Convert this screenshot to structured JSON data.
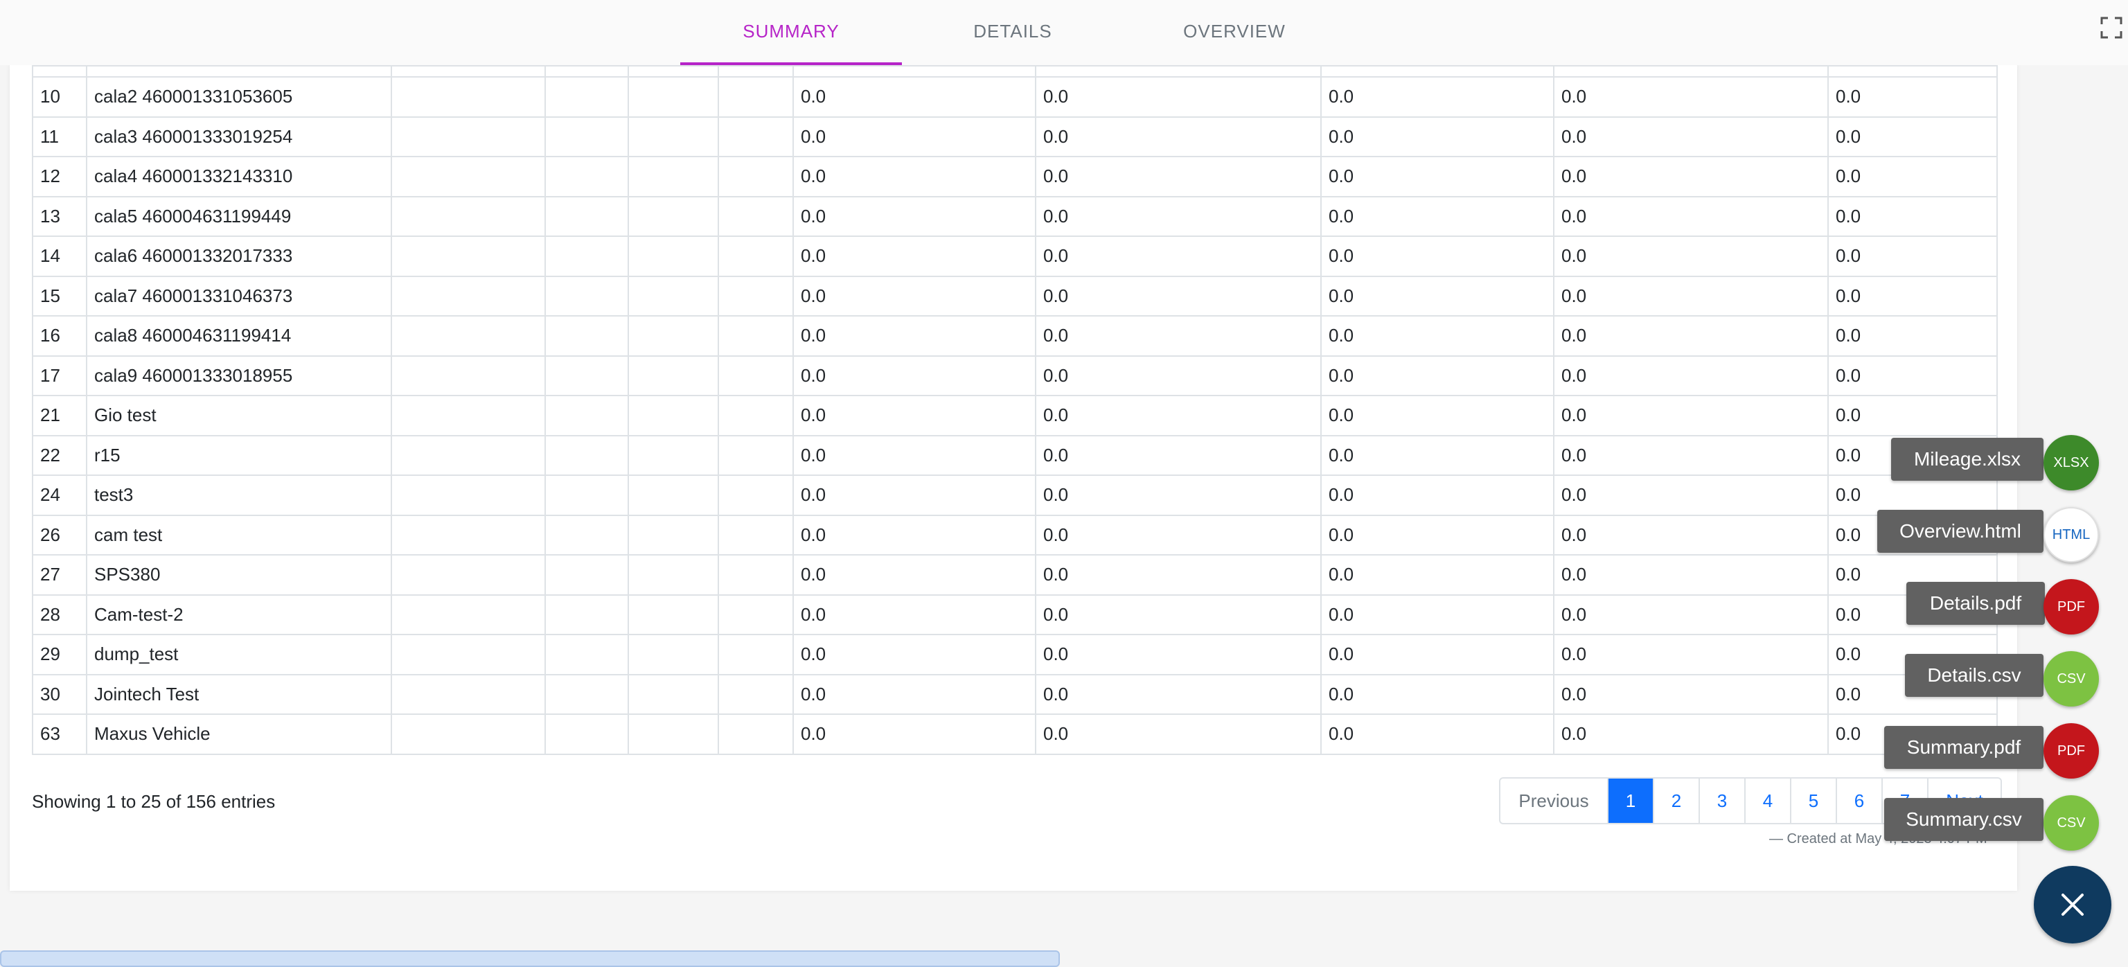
{
  "tabs": [
    {
      "label": "SUMMARY",
      "active": true
    },
    {
      "label": "DETAILS",
      "active": false
    },
    {
      "label": "OVERVIEW",
      "active": false
    }
  ],
  "table": {
    "rows": [
      {
        "id": "10",
        "name": "cala2 460001331053605",
        "values": [
          "0.0",
          "0.0",
          "0.0",
          "0.0",
          "0.0"
        ]
      },
      {
        "id": "11",
        "name": "cala3 460001333019254",
        "values": [
          "0.0",
          "0.0",
          "0.0",
          "0.0",
          "0.0"
        ]
      },
      {
        "id": "12",
        "name": "cala4 460001332143310",
        "values": [
          "0.0",
          "0.0",
          "0.0",
          "0.0",
          "0.0"
        ]
      },
      {
        "id": "13",
        "name": "cala5 460004631199449",
        "values": [
          "0.0",
          "0.0",
          "0.0",
          "0.0",
          "0.0"
        ]
      },
      {
        "id": "14",
        "name": "cala6 460001332017333",
        "values": [
          "0.0",
          "0.0",
          "0.0",
          "0.0",
          "0.0"
        ]
      },
      {
        "id": "15",
        "name": "cala7 460001331046373",
        "values": [
          "0.0",
          "0.0",
          "0.0",
          "0.0",
          "0.0"
        ]
      },
      {
        "id": "16",
        "name": "cala8 460004631199414",
        "values": [
          "0.0",
          "0.0",
          "0.0",
          "0.0",
          "0.0"
        ]
      },
      {
        "id": "17",
        "name": "cala9 460001333018955",
        "values": [
          "0.0",
          "0.0",
          "0.0",
          "0.0",
          "0.0"
        ]
      },
      {
        "id": "21",
        "name": "Gio test",
        "values": [
          "0.0",
          "0.0",
          "0.0",
          "0.0",
          "0.0"
        ]
      },
      {
        "id": "22",
        "name": "r15",
        "values": [
          "0.0",
          "0.0",
          "0.0",
          "0.0",
          "0.0"
        ]
      },
      {
        "id": "24",
        "name": "test3",
        "values": [
          "0.0",
          "0.0",
          "0.0",
          "0.0",
          "0.0"
        ]
      },
      {
        "id": "26",
        "name": "cam test",
        "values": [
          "0.0",
          "0.0",
          "0.0",
          "0.0",
          "0.0"
        ]
      },
      {
        "id": "27",
        "name": "SPS380",
        "values": [
          "0.0",
          "0.0",
          "0.0",
          "0.0",
          "0.0"
        ]
      },
      {
        "id": "28",
        "name": "Cam-test-2",
        "values": [
          "0.0",
          "0.0",
          "0.0",
          "0.0",
          "0.0"
        ]
      },
      {
        "id": "29",
        "name": "dump_test",
        "values": [
          "0.0",
          "0.0",
          "0.0",
          "0.0",
          "0.0"
        ]
      },
      {
        "id": "30",
        "name": "Jointech Test",
        "values": [
          "0.0",
          "0.0",
          "0.0",
          "0.0",
          "0.0"
        ]
      },
      {
        "id": "63",
        "name": "Maxus Vehicle",
        "values": [
          "0.0",
          "0.0",
          "0.0",
          "0.0",
          "0.0"
        ]
      }
    ]
  },
  "footer": {
    "info": "Showing 1 to 25 of 156 entries",
    "created": "— Created at May 4, 2023 4:07 PM"
  },
  "pagination": {
    "previous": "Previous",
    "pages": [
      "1",
      "2",
      "3",
      "4",
      "5",
      "6",
      "7"
    ],
    "active_page": "1",
    "next": "Next"
  },
  "exports": [
    {
      "label": "Mileage.xlsx",
      "badge": "XLSX",
      "color": "#3d8a2a",
      "icon": "xlsx-file-icon"
    },
    {
      "label": "Overview.html",
      "badge": "HTML",
      "color": "#ffffff",
      "icon": "html-file-icon"
    },
    {
      "label": "Details.pdf",
      "badge": "PDF",
      "color": "#c4161c",
      "icon": "pdf-file-icon"
    },
    {
      "label": "Details.csv",
      "badge": "CSV",
      "color": "#7dc242",
      "icon": "csv-file-icon"
    },
    {
      "label": "Summary.pdf",
      "badge": "PDF",
      "color": "#c4161c",
      "icon": "pdf-file-icon"
    },
    {
      "label": "Summary.csv",
      "badge": "CSV",
      "color": "#7dc242",
      "icon": "csv-file-icon"
    }
  ],
  "colors": {
    "accent": "#b624c8",
    "primary": "#0d6efd",
    "fab": "#0f3a5f"
  }
}
